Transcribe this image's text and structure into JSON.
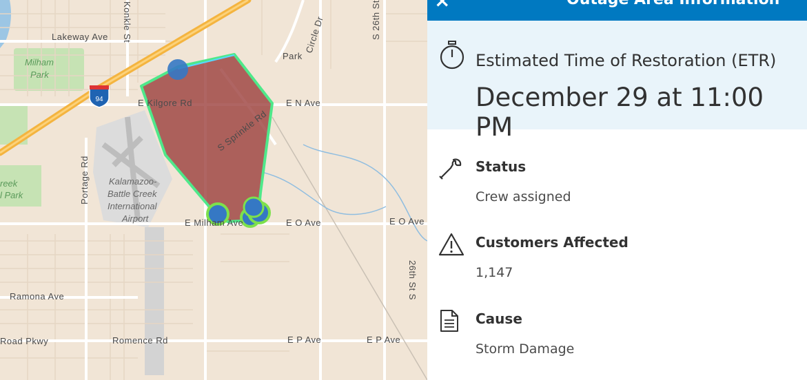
{
  "map": {
    "roads": {
      "lakeway": "Lakeway Ave",
      "konkle": "Konkle St",
      "park": "Park",
      "circle": "Circle Dr",
      "s26th_top": "S 26th St",
      "kilgore": "E Kilgore Rd",
      "en": "E N Ave",
      "sprinkle": "S Sprinkle Rd",
      "portage": "Portage Rd",
      "milham": "E Milham Ave",
      "eo1": "E O Ave",
      "eo2": "E O Ave",
      "s26th_bottom": "26th St S",
      "ramona": "Ramona Ave",
      "road_pkwy": "Road Pkwy",
      "romence": "Romence Rd",
      "ep1": "E P Ave",
      "ep2": "E P Ave",
      "interstate": "94"
    },
    "parks": {
      "milham_line1": "Milham",
      "milham_line2": "Park",
      "creek_line1": "reek",
      "creek_line2": "l Park"
    },
    "airport": {
      "line1": "Kalamazoo-",
      "line2": "Battle Creek",
      "line3": "International",
      "line4": "Airport"
    },
    "outage_fill": "#9b3f3c",
    "outage_stroke": "#4fe88a"
  },
  "panel": {
    "title": "Outage Area Information",
    "close_label": "×",
    "etr_label": "Estimated Time of Restoration (ETR)",
    "etr_value": "December 29 at 11:00 PM",
    "status_label": "Status",
    "status_value": "Crew assigned",
    "customers_label": "Customers Affected",
    "customers_value": "1,147",
    "cause_label": "Cause",
    "cause_value": "Storm Damage",
    "icons": {
      "etr": "stopwatch-icon",
      "status": "wrench-icon",
      "customers": "warning-icon",
      "cause": "document-icon"
    }
  }
}
